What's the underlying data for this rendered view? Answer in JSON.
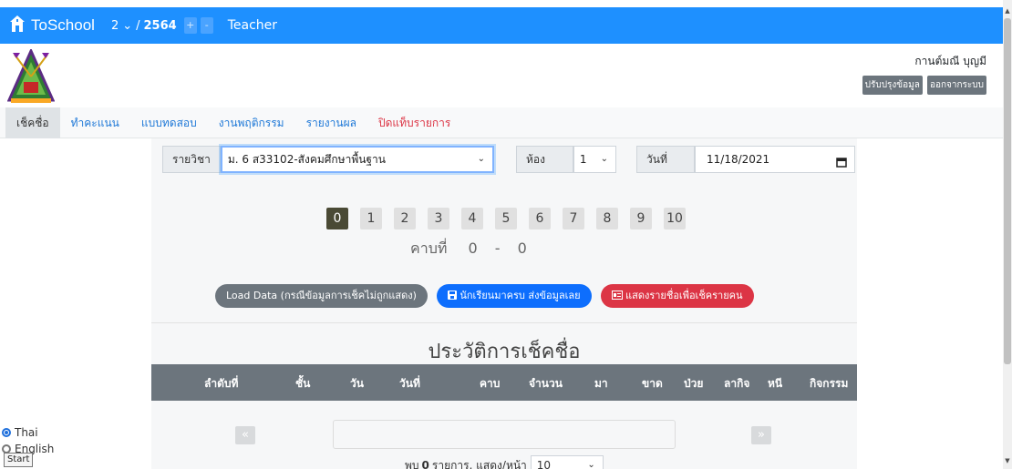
{
  "navbar": {
    "brand": "ToSchool",
    "term": "2",
    "term_chevron": "⌄",
    "slash": "/",
    "year": "2564",
    "plus": "+",
    "minus": "-",
    "role": "Teacher"
  },
  "user": {
    "name": "กานต์มณี บุญมี",
    "update_button": "ปรับปรุงข้อมูล",
    "logout_button": "ออกจากระบบ"
  },
  "tabs": [
    {
      "label": "เช็คชื่อ"
    },
    {
      "label": "ทำคะแนน"
    },
    {
      "label": "แบบทดสอบ"
    },
    {
      "label": "งานพฤติกรรม"
    },
    {
      "label": "รายงานผล"
    },
    {
      "label": "ปิดแท็บรายการ"
    }
  ],
  "filters": {
    "subject_label": "รายวิชา",
    "subject_value": "ม. 6 ส33102-สังคมศึกษาพื้นฐาน",
    "room_label": "ห้อง",
    "room_value": "1",
    "date_label": "วันที่",
    "date_value": "11/18/2021"
  },
  "pages": [
    "0",
    "1",
    "2",
    "3",
    "4",
    "5",
    "6",
    "7",
    "8",
    "9",
    "10"
  ],
  "period": {
    "label": "คาบที่",
    "from": "0",
    "dash": "-",
    "to": "0"
  },
  "actions": {
    "load": "Load Data (กรณีข้อมูลการเช็คไม่ถูกแสดง)",
    "submit_all": "นักเรียนมาครบ ส่งข้อมูลเลย",
    "show_list": "แสดงรายชื่อเพื่อเช็ครายคน"
  },
  "history": {
    "title": "ประวัติการเช็คชื่อ",
    "columns": [
      "ลำดับที่",
      "ชั้น",
      "วัน",
      "วันที่",
      "คาบ",
      "จำนวน",
      "มา",
      "ขาด",
      "ป่วย",
      "ลากิจ",
      "หนี",
      "กิจกรรม"
    ],
    "prev": "«",
    "next": "»",
    "found_prefix": "พบ",
    "found_count": "0",
    "found_suffix": "รายการ, แสดง/หน้า",
    "per_page": "10"
  },
  "language": {
    "thai": "Thai",
    "english": "English"
  },
  "taskbar_tip": "Start",
  "colors": {
    "navbar": "#1e90ff",
    "danger": "#dc3545",
    "primary": "#0d6efd",
    "secondary": "#6c757d"
  }
}
